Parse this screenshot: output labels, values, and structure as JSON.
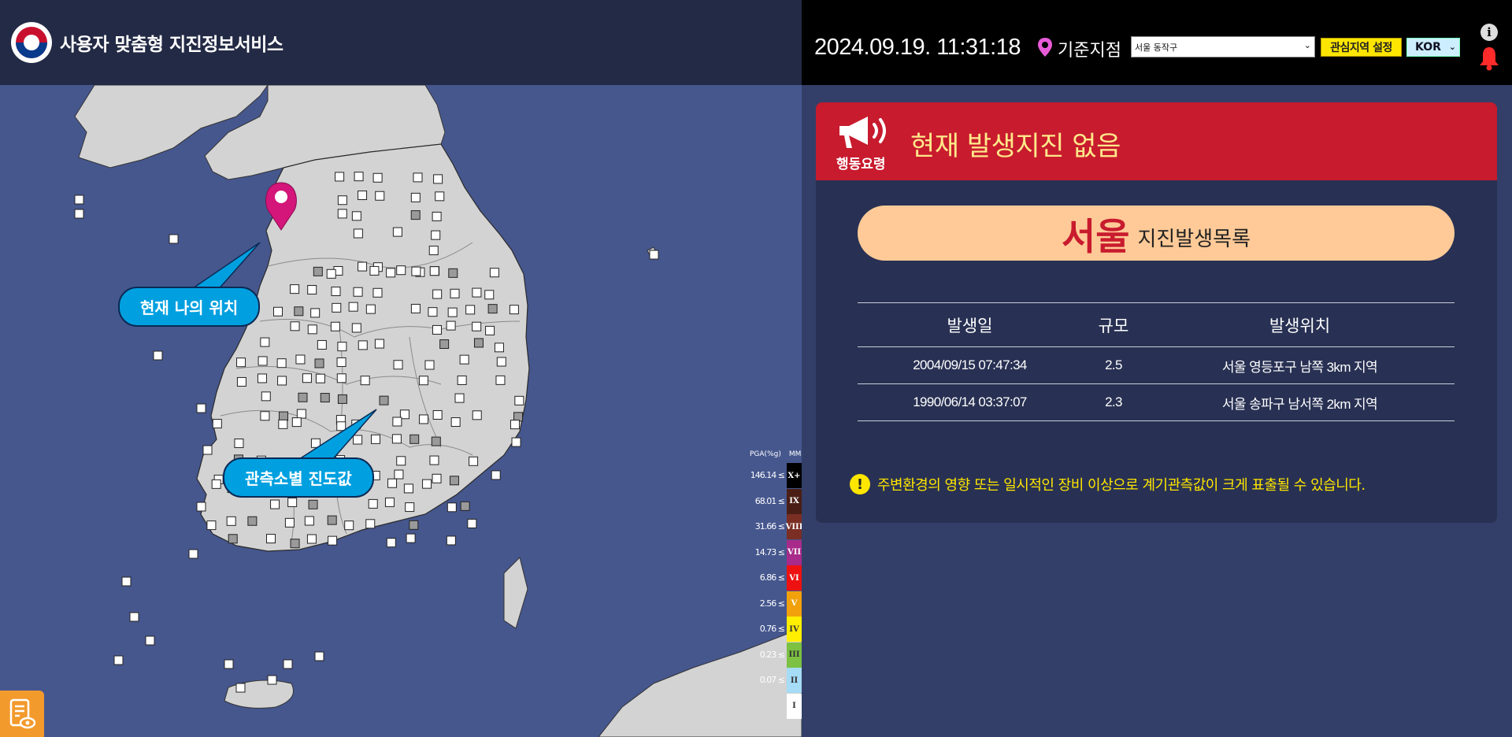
{
  "header": {
    "app_title": "사용자 맞춤형 지진정보서비스"
  },
  "topbar": {
    "datetime": "2024.09.19. 11:31:18",
    "base_label": "기준지점",
    "base_select_value": "서울 동작구",
    "interest_button": "관심지역 설정",
    "language": "KOR"
  },
  "map": {
    "callout_location": "현재 나의 위치",
    "callout_intensity": "관측소별 진도값",
    "legend": {
      "pga_header": "PGA(%g)",
      "mmi_header": "MMI",
      "rows": [
        {
          "threshold": "146.14 ≤",
          "level": "X+",
          "color": "#000000",
          "text": "#ffffff"
        },
        {
          "threshold": "68.01 ≤",
          "level": "IX",
          "color": "#4a1e14",
          "text": "#ffffff"
        },
        {
          "threshold": "31.66 ≤",
          "level": "VIII",
          "color": "#7a2e24",
          "text": "#ffffff"
        },
        {
          "threshold": "14.73 ≤",
          "level": "VII",
          "color": "#a82a8a",
          "text": "#ffffff"
        },
        {
          "threshold": "6.86 ≤",
          "level": "VI",
          "color": "#ee1111",
          "text": "#ffffff"
        },
        {
          "threshold": "2.56 ≤",
          "level": "V",
          "color": "#f2a10d",
          "text": "#ffffff"
        },
        {
          "threshold": "0.76 ≤",
          "level": "IV",
          "color": "#ffee00",
          "text": "#333333"
        },
        {
          "threshold": "0.23 ≤",
          "level": "III",
          "color": "#7cc142",
          "text": "#333333"
        },
        {
          "threshold": "0.07 ≤",
          "level": "II",
          "color": "#a6dcf5",
          "text": "#333333"
        },
        {
          "threshold": "",
          "level": "I",
          "color": "#ffffff",
          "text": "#333333"
        }
      ]
    }
  },
  "panel": {
    "action_label": "행동요령",
    "alert_text": "현재 발생지진 없음",
    "city_name": "서울",
    "city_suffix": "지진발생목록",
    "table": {
      "headers": [
        "발생일",
        "규모",
        "발생위치"
      ],
      "rows": [
        [
          "2004/09/15 07:47:34",
          "2.5",
          "서울 영등포구 남쪽 3km 지역"
        ],
        [
          "1990/06/14 03:37:07",
          "2.3",
          "서울 송파구 남서쪽 2km 지역"
        ]
      ]
    },
    "notice": "주변환경의 영향 또는 일시적인 장비 이상으로 계기관측값이 크게 표출될 수 있습니다.",
    "notice_icon": "!",
    "info_icon": "i"
  },
  "colors": {
    "alert_red": "#c81b2e",
    "alert_yellow": "#ffe88a",
    "pill": "#ffca97",
    "sea": "#46578e",
    "land": "#d3d3d3",
    "pin": "#d4157a",
    "callout": "#00a0e0"
  },
  "icons": [
    "taegeuk-logo-icon",
    "location-pin-icon",
    "info-icon",
    "bell-icon",
    "megaphone-icon",
    "warning-icon",
    "report-icon"
  ]
}
